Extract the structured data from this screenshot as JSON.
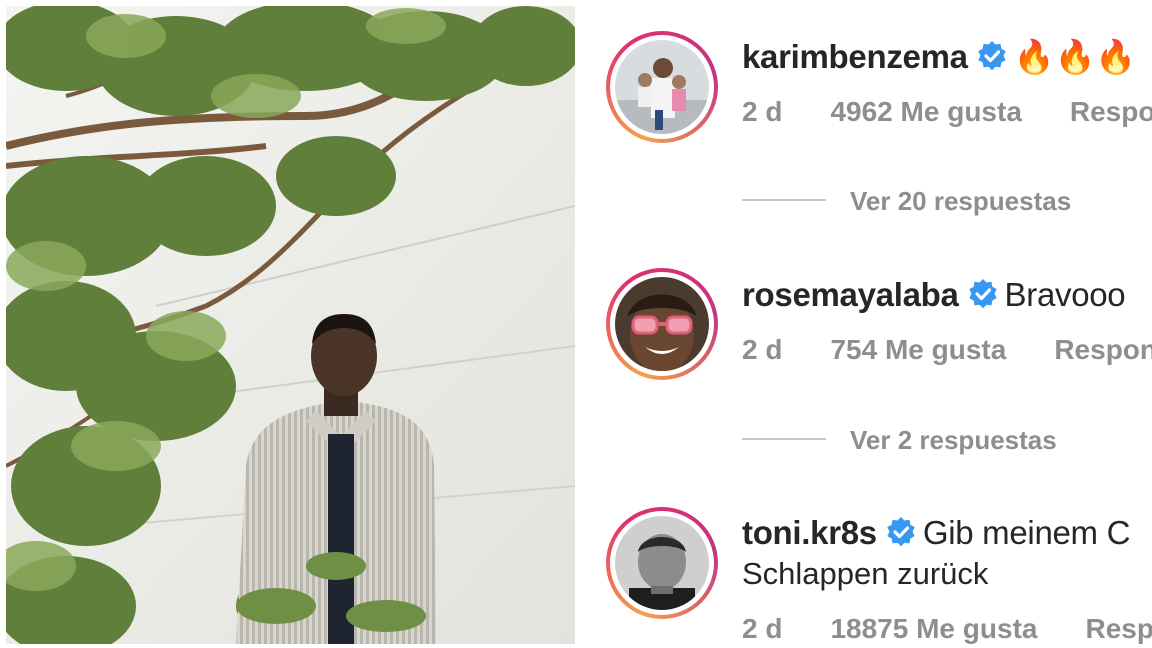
{
  "comments": [
    {
      "username": "karimbenzema",
      "text": "🔥🔥🔥",
      "time": "2 d",
      "likes": "4962 Me gusta",
      "reply": "Responder",
      "view_replies": "Ver 20 respuestas"
    },
    {
      "username": "rosemayalaba",
      "text": "Bravooo",
      "time": "2 d",
      "likes": "754 Me gusta",
      "reply": "Responder",
      "view_replies": "Ver 2 respuestas"
    },
    {
      "username": "toni.kr8s",
      "text": "Gib meinem C",
      "text_line2": "Schlappen zurück",
      "time": "2 d",
      "likes": "18875 Me gusta",
      "reply": "Responder"
    }
  ],
  "colors": {
    "verified_blue": "#3897f0",
    "meta_gray": "#8e8e8e",
    "text": "#262626"
  },
  "icons": [
    "verified-badge-icon"
  ]
}
